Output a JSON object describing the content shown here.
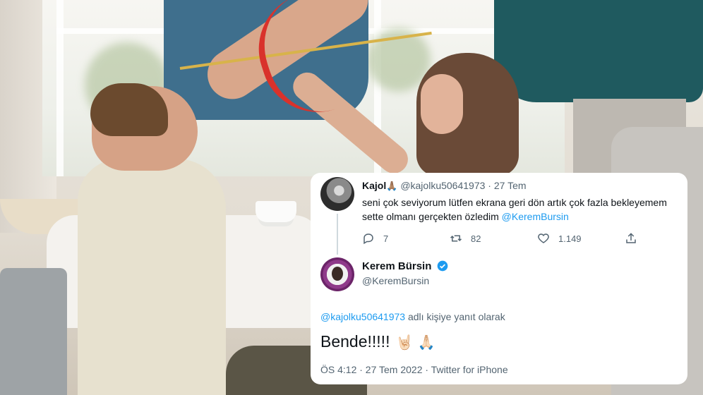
{
  "reply_tweet": {
    "display_name": "Kajol",
    "name_emoji": "🙏🏽",
    "handle": "@kajolku50641973",
    "separator": "·",
    "date": "27 Tem",
    "text_line1": "seni çok seviyorum lütfen ekrana geri dön artık çok fazla bekleyemem",
    "text_line2_prefix": "sette olmanı gerçekten özledim",
    "text_mention": "@KeremBursin",
    "replies": "7",
    "retweets": "82",
    "likes": "1.149"
  },
  "main_tweet": {
    "display_name": "Kerem Bürsin",
    "handle": "@KeremBursin",
    "reply_to_handle": "@kajolku50641973",
    "reply_to_suffix": "adlı kişiye yanıt olarak",
    "text": "Bende!!!!!",
    "emojis": "🤘🏻 🙏🏻",
    "timestamp": "ÖS 4:12 · 27 Tem 2022 · Twitter for iPhone"
  },
  "colors": {
    "link": "#1d9bf0",
    "muted": "#536471",
    "verified": "#1d9bf0"
  },
  "icons": {
    "reply": "reply-icon",
    "retweet": "retweet-icon",
    "like": "heart-icon",
    "share": "share-icon",
    "verified": "verified-badge-icon"
  }
}
